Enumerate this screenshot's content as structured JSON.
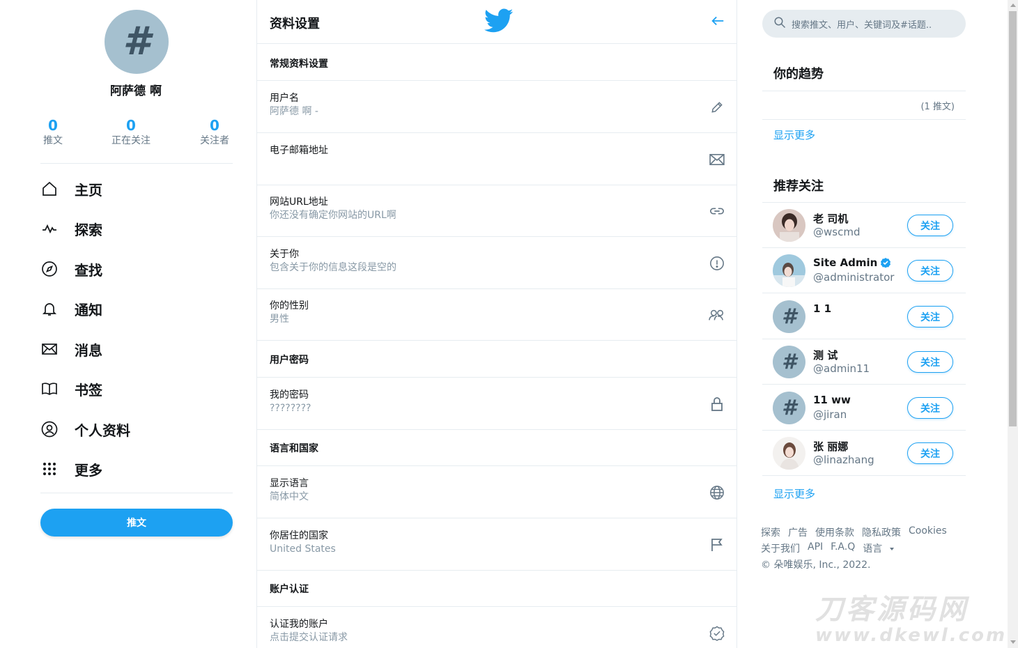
{
  "profile": {
    "avatar_glyph": "#",
    "name": "阿萨德 啊",
    "stats": [
      {
        "num": "0",
        "label": "推文"
      },
      {
        "num": "0",
        "label": "正在关注"
      },
      {
        "num": "0",
        "label": "关注者"
      }
    ]
  },
  "nav": [
    {
      "label": "主页",
      "icon": "home-icon"
    },
    {
      "label": "探索",
      "icon": "pulse-icon"
    },
    {
      "label": "查找",
      "icon": "compass-icon"
    },
    {
      "label": "通知",
      "icon": "bell-icon"
    },
    {
      "label": "消息",
      "icon": "envelope-icon"
    },
    {
      "label": "书签",
      "icon": "book-icon"
    },
    {
      "label": "个人资料",
      "icon": "user-circle-icon"
    },
    {
      "label": "更多",
      "icon": "dots-grid-icon"
    }
  ],
  "tweet_button": "推文",
  "settings": {
    "title": "资料设置",
    "sections": {
      "general": "常规资料设置",
      "password": "用户密码",
      "language": "语言和国家",
      "verify": "账户认证"
    },
    "rows": {
      "username": {
        "title": "用户名",
        "value": "阿萨德 啊 -"
      },
      "email": {
        "title": "电子邮箱地址",
        "value": ""
      },
      "website": {
        "title": "网站URL地址",
        "value": "你还没有确定你网站的URL啊"
      },
      "about": {
        "title": "关于你",
        "value": "包含关于你的信息这段是空的"
      },
      "gender": {
        "title": "你的性别",
        "value": "男性"
      },
      "password": {
        "title": "我的密码",
        "value": "????????"
      },
      "display_lang": {
        "title": "显示语言",
        "value": "简体中文"
      },
      "country": {
        "title": "你居住的国家",
        "value": "United States"
      },
      "verify_account": {
        "title": "认证我的账户",
        "value": "点击提交认证请求"
      }
    }
  },
  "search": {
    "placeholder": "搜索推文、用户、关键词及#话题.."
  },
  "trends": {
    "title": "你的趋势",
    "count": "(1 推文)",
    "show_more": "显示更多"
  },
  "follow": {
    "title": "推荐关注",
    "button": "关注",
    "show_more": "显示更多",
    "users": [
      {
        "name": "老 司机",
        "handle": "@wscmd",
        "avatar": "photo",
        "verified": false
      },
      {
        "name": "Site Admin",
        "handle": "@administrator",
        "avatar": "photo",
        "verified": true
      },
      {
        "name": "1 1",
        "handle": "",
        "avatar": "hash",
        "verified": false
      },
      {
        "name": "测 试",
        "handle": "@admin11",
        "avatar": "hash",
        "verified": false
      },
      {
        "name": "11 ww",
        "handle": "@jiran",
        "avatar": "hash",
        "verified": false
      },
      {
        "name": "张 丽娜",
        "handle": "@linazhang",
        "avatar": "photo",
        "verified": false
      }
    ]
  },
  "footer": {
    "line1": [
      "探索",
      "广告",
      "使用条款",
      "隐私政策",
      "Cookies"
    ],
    "line2": [
      "关于我们",
      "API",
      "F.A.Q",
      "语言"
    ],
    "copyright": "© 朵唯娱乐, Inc., 2022."
  },
  "watermark": {
    "line1": "刀客源码网",
    "line2": "www.dkewl.com"
  },
  "colors": {
    "accent": "#1da1f2",
    "avatar_placeholder": "#a5c0cf"
  }
}
